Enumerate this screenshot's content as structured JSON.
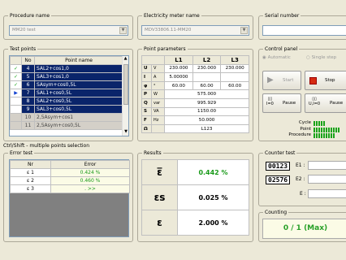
{
  "procedure": {
    "legend": "Procedure name",
    "value": "MM20 test"
  },
  "meter": {
    "legend": "Electricity meter name",
    "value": "MDV33806.11-MM20"
  },
  "serial": {
    "legend": "Serial number",
    "value": ""
  },
  "test_points": {
    "legend": "Test points",
    "col_no": "No",
    "col_name": "Point name",
    "rows": [
      {
        "check": "✓",
        "no": "4",
        "name": "SAL2+cos1,0",
        "sel": true
      },
      {
        "check": "✓",
        "no": "5",
        "name": "SAL3+cos1,0",
        "sel": true
      },
      {
        "check": "✓",
        "no": "6",
        "name": "SAsym+cos0,5L",
        "sel": true
      },
      {
        "check": "▶",
        "no": "7",
        "name": "SAL1+cos0,5L",
        "sel": true
      },
      {
        "check": "",
        "no": "8",
        "name": "SAL2+cos0,5L",
        "sel": true
      },
      {
        "check": "",
        "no": "9",
        "name": "SAL3+cos0,5L",
        "sel": true
      },
      {
        "check": "",
        "no": "10",
        "name": "2,5Asym+cos1",
        "sel": false
      },
      {
        "check": "",
        "no": "11",
        "name": "2,5Asym+cos0,5L",
        "sel": false
      }
    ],
    "hint": "Ctrl/Shift - multiple points selection"
  },
  "params": {
    "legend": "Point parameters",
    "headers": [
      "L1",
      "L2",
      "L3"
    ],
    "rows": [
      {
        "sym": "U",
        "unit": "V",
        "vals": [
          "230.000",
          "230.000",
          "230.000"
        ]
      },
      {
        "sym": "I",
        "unit": "A",
        "vals": [
          "5.00000",
          "",
          ""
        ]
      },
      {
        "sym": "φ",
        "unit": "°",
        "vals": [
          "60.00",
          "60.00",
          "60.00"
        ]
      }
    ],
    "totals": [
      {
        "sym": "P",
        "unit": "W",
        "val": "575.000"
      },
      {
        "sym": "Q",
        "unit": "var",
        "val": "995.929"
      },
      {
        "sym": "S",
        "unit": "VA",
        "val": "1150.00"
      },
      {
        "sym": "F",
        "unit": "Hz",
        "val": "50.000"
      },
      {
        "sym": "Ω",
        "unit": "",
        "val": "L123"
      }
    ]
  },
  "control": {
    "legend": "Control panel",
    "mode_auto": "Automatic",
    "mode_single": "Single step",
    "start": "Start",
    "stop": "Stop",
    "pause1": "Pause",
    "pause2": "Pause",
    "cycle": "Cycle",
    "point": "Point",
    "procedure": "Procedure",
    "cycle_bars": 5,
    "point_bars": 11,
    "procedure_bars": 9
  },
  "error_test": {
    "legend": "Error test",
    "col_nr": "Nr",
    "col_err": "Error",
    "rows": [
      {
        "nr": "ε 1",
        "err": "0.424 %"
      },
      {
        "nr": "ε 2",
        "err": "0.460 %"
      },
      {
        "nr": "ε 3",
        "err": ". >>"
      }
    ]
  },
  "results": {
    "legend": "Results",
    "rows": [
      {
        "sym": "ε̅",
        "val": "0.442 %"
      },
      {
        "sym": "εs",
        "val": "0.025 %"
      },
      {
        "sym": "ε",
        "val": "2.000 %"
      }
    ]
  },
  "counter": {
    "legend": "Counter test",
    "c1": "00123",
    "c2": "02576",
    "e1": "E1 :",
    "e2": "E2 :",
    "e": "E :"
  },
  "counting": {
    "legend": "Counting",
    "value": "0 / 1  (Max)"
  }
}
